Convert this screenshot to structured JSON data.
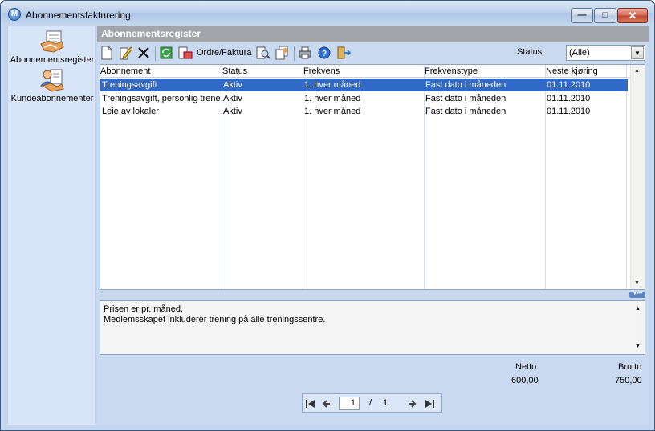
{
  "window": {
    "title": "Abonnementsfakturering",
    "min_glyph": "—",
    "max_glyph": "□",
    "close_glyph": "✕"
  },
  "sidebar": {
    "items": [
      {
        "label": "Abonnementsregister",
        "icon": "register-icon"
      },
      {
        "label": "Kundeabonnementer",
        "icon": "customer-subscriptions-icon"
      }
    ]
  },
  "panel": {
    "title": "Abonnementsregister"
  },
  "toolbar": {
    "order_invoice_label": "Ordre/Faktura"
  },
  "filter": {
    "status_label": "Status",
    "status_value": "(Alle)"
  },
  "grid": {
    "columns": [
      "Abonnement",
      "Status",
      "Frekvens",
      "Frekvenstype",
      "Neste kjøring"
    ],
    "rows": [
      {
        "abonnement": "Treningsavgift",
        "status": "Aktiv",
        "frekvens": "1. hver måned",
        "frekvenstype": "Fast dato i måneden",
        "neste": "01.11.2010",
        "selected": true
      },
      {
        "abonnement": "Treningsavgift, personlig trener",
        "status": "Aktiv",
        "frekvens": "1. hver måned",
        "frekvenstype": "Fast dato i måneden",
        "neste": "01.11.2010",
        "selected": false
      },
      {
        "abonnement": "Leie av lokaler",
        "status": "Aktiv",
        "frekvens": "1. hver måned",
        "frekvenstype": "Fast dato i måneden",
        "neste": "01.11.2010",
        "selected": false
      }
    ]
  },
  "notes": {
    "line1": "Prisen er pr. måned.",
    "line2": "Medlemsskapet inkluderer trening på alle treningssentre."
  },
  "totals": {
    "netto_label": "Netto",
    "netto_value": "600,00",
    "brutto_label": "Brutto",
    "brutto_value": "750,00"
  },
  "pager": {
    "current": "1",
    "separator": "/",
    "total": "1"
  },
  "colors": {
    "selection": "#3169c6",
    "panel_header": "#a2a6ab",
    "sidebar": "#d8e4f8"
  }
}
